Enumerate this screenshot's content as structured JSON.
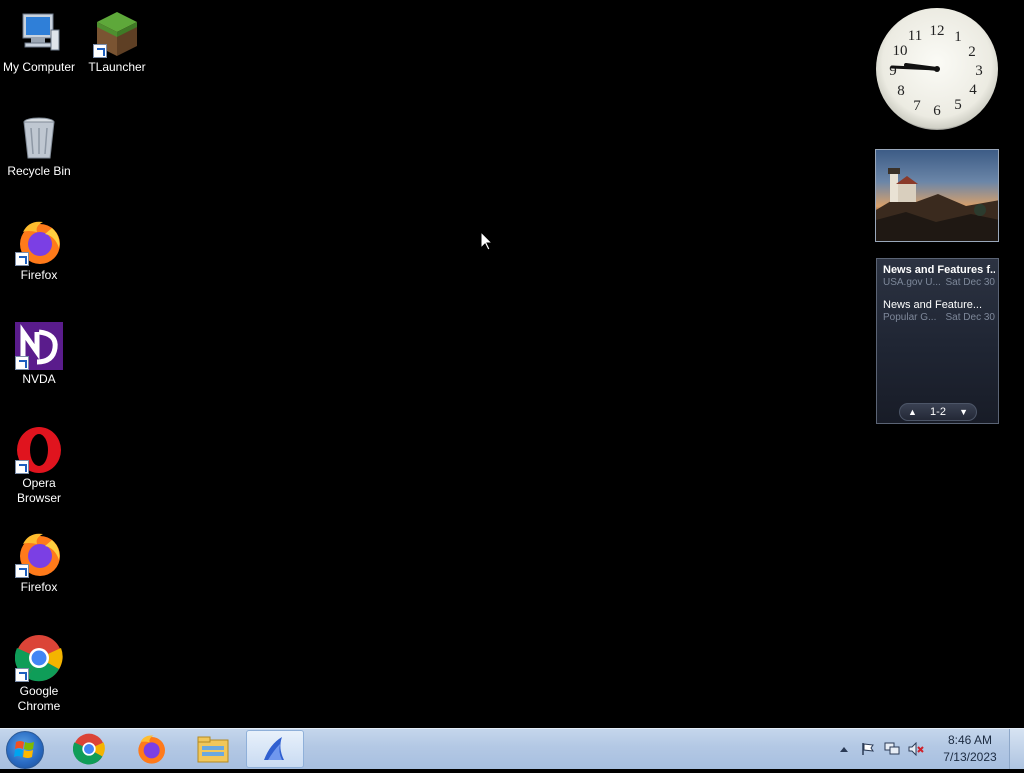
{
  "desktop": {
    "icons": [
      {
        "label": "My Computer"
      },
      {
        "label": "TLauncher"
      },
      {
        "label": "Recycle Bin"
      },
      {
        "label": "Firefox"
      },
      {
        "label": "NVDA"
      },
      {
        "label": "Opera Browser"
      },
      {
        "label": "Firefox"
      },
      {
        "label": "Google Chrome"
      }
    ]
  },
  "gadgets": {
    "clock": {
      "numbers": [
        "12",
        "1",
        "2",
        "3",
        "4",
        "5",
        "6",
        "7",
        "8",
        "9",
        "10",
        "11"
      ]
    },
    "feeds": {
      "items": [
        {
          "title": "News and Features f...",
          "source": "USA.gov U...",
          "date": "Sat Dec 30"
        },
        {
          "title": "News and Feature...",
          "source": "Popular G...",
          "date": "Sat Dec 30"
        }
      ],
      "page_indicator": "1-2"
    }
  },
  "taskbar": {
    "time": "8:46 AM",
    "date": "7/13/2023"
  },
  "colors": {
    "desktop_bg": "#000000",
    "taskbar_bg": "#b3c8e4"
  }
}
